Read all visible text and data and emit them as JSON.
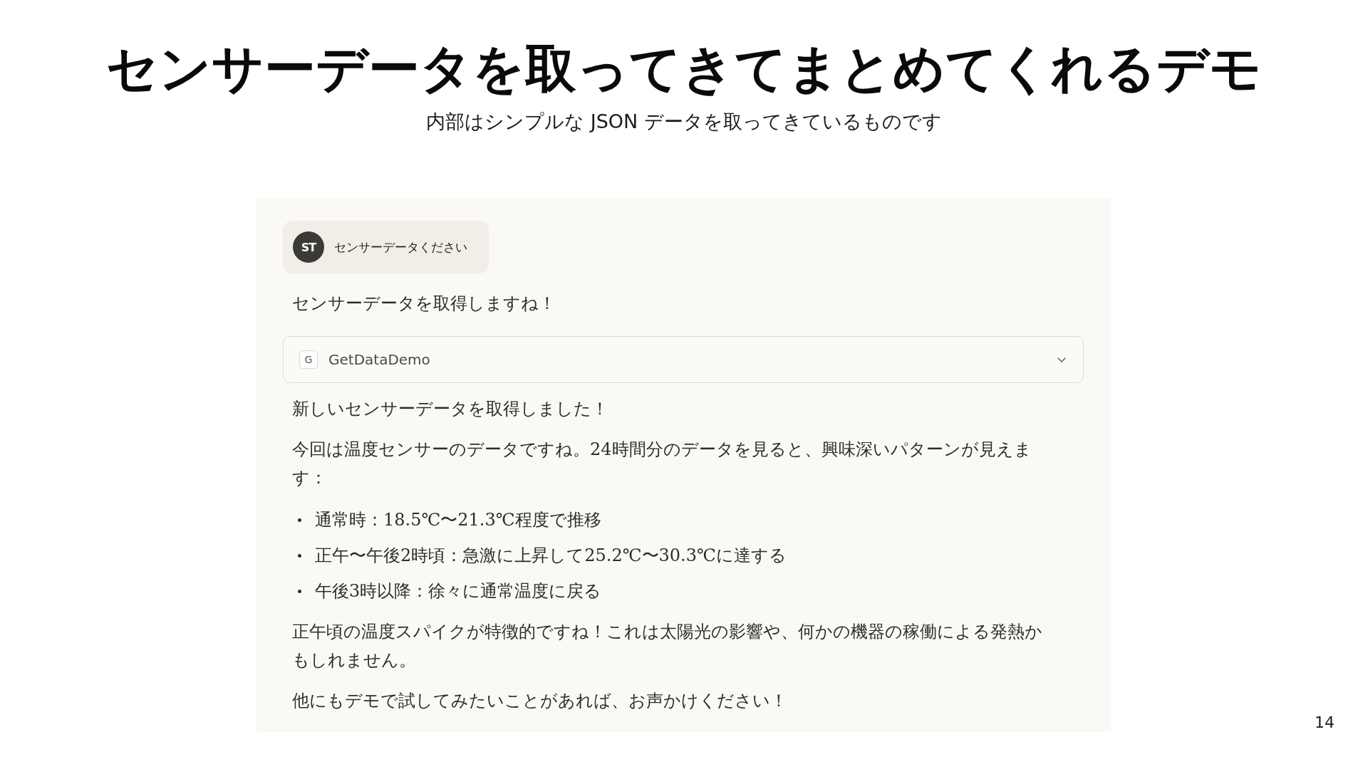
{
  "slide": {
    "title": "センサーデータを取ってきてまとめてくれるデモ",
    "subtitle": "内部はシンプルな JSON データを取ってきているものです",
    "page_number": "14"
  },
  "chat": {
    "user_message": {
      "avatar_initials": "ST",
      "text": "センサーデータください"
    },
    "assistant_intro": "センサーデータを取得しますね！",
    "tool_call": {
      "icon_letter": "G",
      "name": "GetDataDemo",
      "expanded": false
    },
    "response": [
      {
        "kind": "paragraph",
        "text": "新しいセンサーデータを取得しました！"
      },
      {
        "kind": "paragraph",
        "text": "今回は温度センサーのデータですね。24時間分のデータを見ると、興味深いパターンが見えます："
      },
      {
        "kind": "bullet_list",
        "items": [
          "通常時：18.5℃〜21.3℃程度で推移",
          "正午〜午後2時頃：急激に上昇して25.2℃〜30.3℃に達する",
          "午後3時以降：徐々に通常温度に戻る"
        ]
      },
      {
        "kind": "paragraph",
        "text": "正午頃の温度スパイクが特徴的ですね！これは太陽光の影響や、何かの機器の稼働による発熱かもしれません。"
      },
      {
        "kind": "paragraph",
        "text": "他にもデモで試してみたいことがあれば、お声かけください！"
      }
    ]
  }
}
